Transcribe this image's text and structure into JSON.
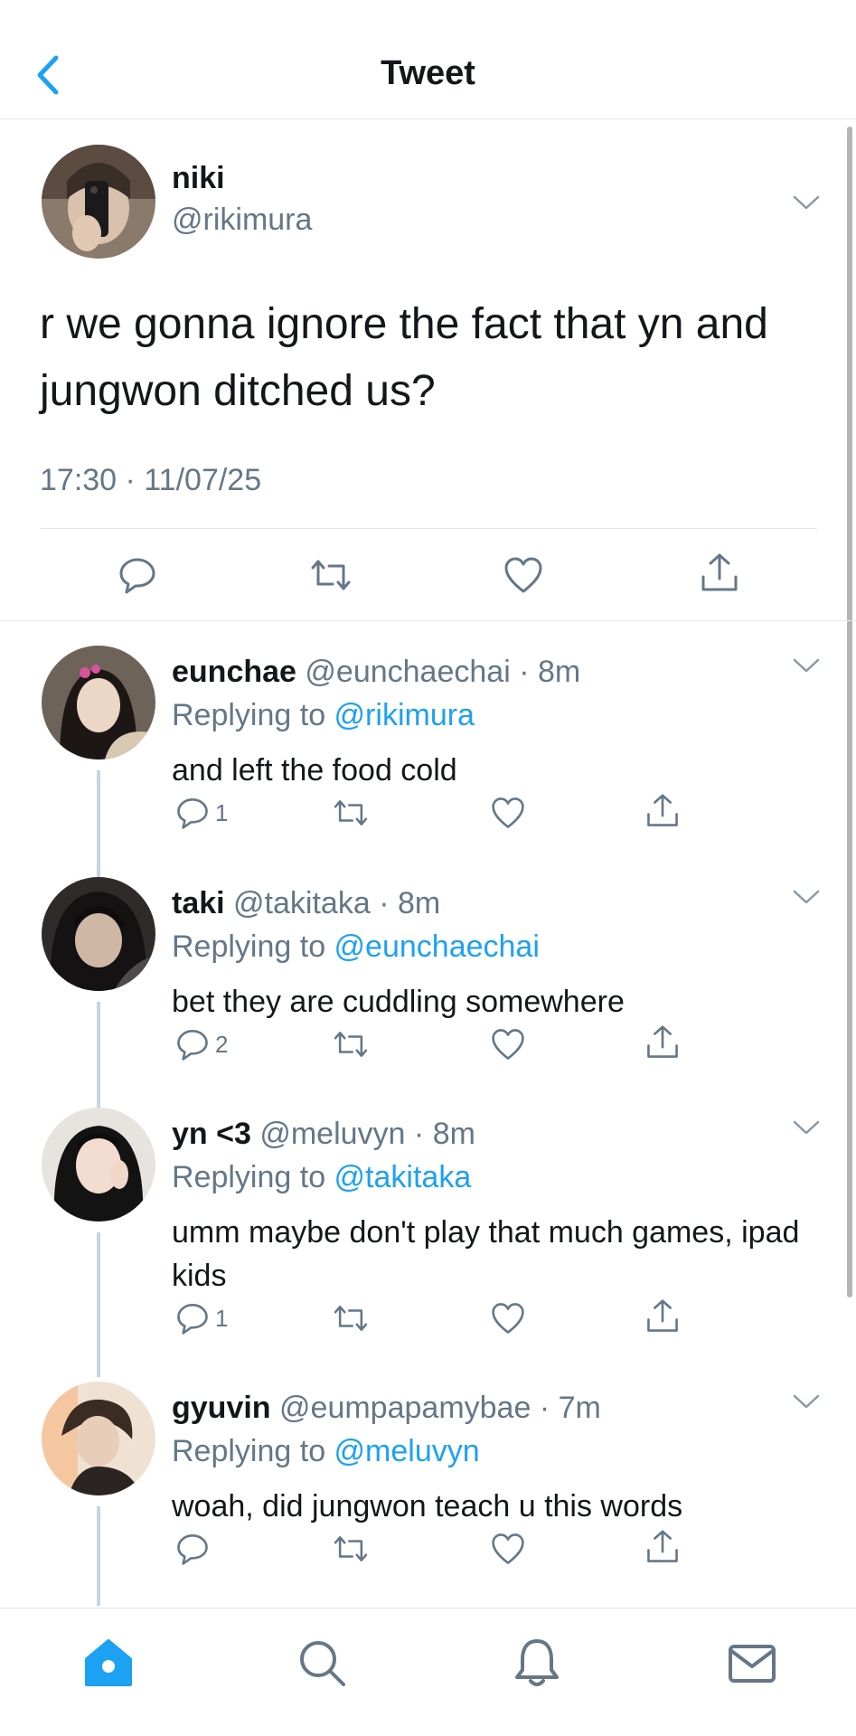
{
  "header": {
    "title": "Tweet",
    "back_icon": "chevron-left-icon"
  },
  "colors": {
    "accent": "#1da1f2",
    "secondary_text": "#657786",
    "thread_line": "#c6d4dd"
  },
  "main_tweet": {
    "name": "niki",
    "handle": "@rikimura",
    "text": "r we gonna ignore the fact that yn and jungwon ditched us?",
    "timestamp": "17:30 · 11/07/25",
    "actions": [
      "reply-icon",
      "retweet-icon",
      "like-icon",
      "share-icon"
    ]
  },
  "replies": [
    {
      "name": "eunchae",
      "handle": "@eunchaechai",
      "time": "8m",
      "replying_prefix": "Replying to ",
      "replying_to": "@rikimura",
      "text": "and left the food cold",
      "reply_count": "1"
    },
    {
      "name": "taki",
      "handle": "@takitaka",
      "time": "8m",
      "replying_prefix": "Replying to ",
      "replying_to": "@eunchaechai",
      "text": "bet they are cuddling somewhere",
      "reply_count": "2"
    },
    {
      "name": "yn <3",
      "handle": "@meluvyn",
      "time": "8m",
      "replying_prefix": "Replying to ",
      "replying_to": "@takitaka",
      "text": "umm maybe don't play that much games, ipad kids",
      "reply_count": "1"
    },
    {
      "name": "gyuvin",
      "handle": "@eumpapamybae",
      "time": "7m",
      "replying_prefix": "Replying to ",
      "replying_to": "@meluvyn",
      "text": "woah, did jungwon teach u this words",
      "reply_count": ""
    }
  ],
  "tabbar": {
    "tabs": [
      "home-icon",
      "search-icon",
      "notifications-icon",
      "messages-icon"
    ],
    "active": "home-icon"
  }
}
